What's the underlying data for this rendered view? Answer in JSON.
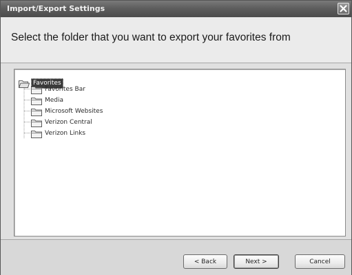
{
  "window": {
    "title": "Import/Export Settings"
  },
  "header": {
    "instruction": "Select the folder that you want to export your favorites from"
  },
  "tree": {
    "root": {
      "label": "Favorites",
      "selected": true,
      "icon": "folder-open-icon"
    },
    "children": [
      {
        "label": "Favorites Bar",
        "icon": "folder-icon"
      },
      {
        "label": "Media",
        "icon": "folder-icon"
      },
      {
        "label": "Microsoft Websites",
        "icon": "folder-icon"
      },
      {
        "label": "Verizon Central",
        "icon": "folder-icon"
      },
      {
        "label": "Verizon Links",
        "icon": "folder-icon"
      }
    ]
  },
  "buttons": {
    "back": "< Back",
    "next": "Next >",
    "cancel": "Cancel"
  },
  "colors": {
    "titlebar": "#5e5e5e",
    "selection": "#3b3b3b",
    "dialog_background": "#d8d8d8",
    "header_background": "#ebebeb"
  }
}
